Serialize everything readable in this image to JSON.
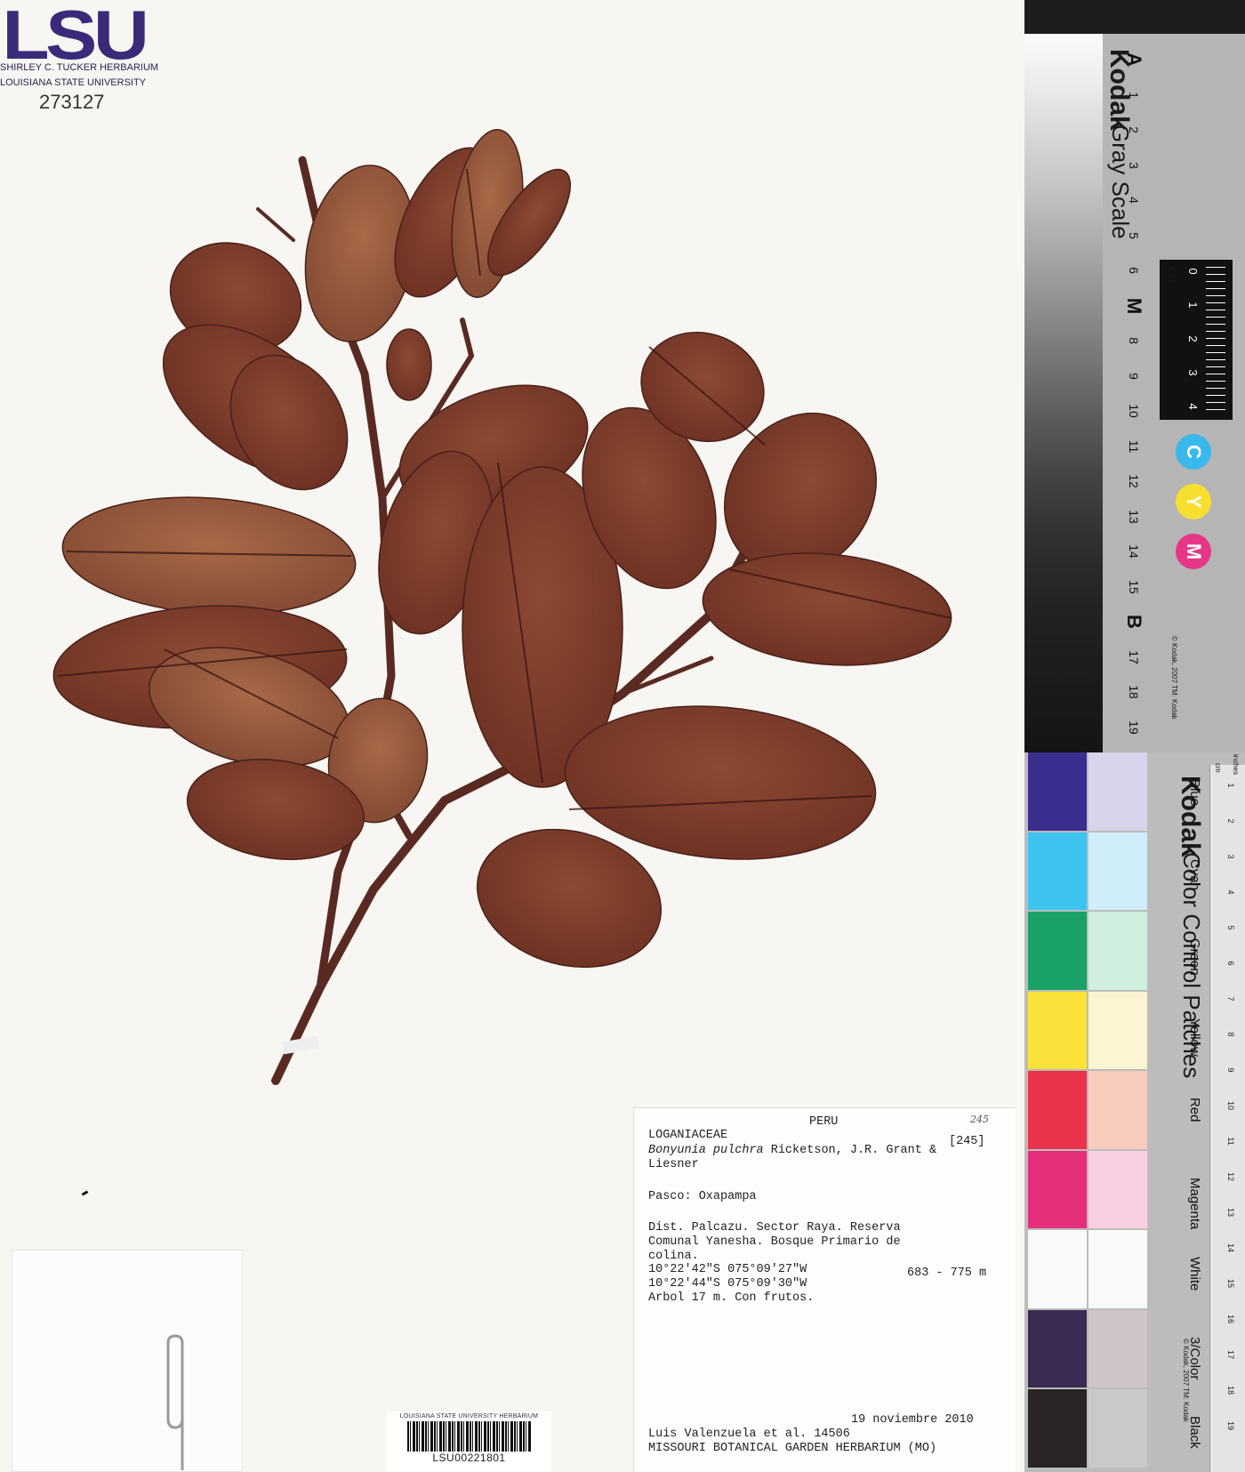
{
  "herbarium_header": {
    "logo": "LSU",
    "line1": "SHIRLEY C. TUCKER HERBARIUM",
    "line2": "LOUISIANA STATE UNIVERSITY",
    "number": "273127"
  },
  "barcode": {
    "org": "LOUISIANA STATE UNIVERSITY HERBARIUM",
    "id": "LSU00221801"
  },
  "label": {
    "country": "PERU",
    "hand_note": "245",
    "family": "LOGANIACEAE",
    "number_bracket": "[245]",
    "taxon_italic": "Bonyunia pulchra",
    "taxon_author": "Ricketson, J.R. Grant &",
    "taxon_author2": "Liesner",
    "locality_header": "Pasco: Oxapampa",
    "desc1": "Dist. Palcazu. Sector Raya. Reserva",
    "desc2": "Comunal Yanesha. Bosque Primario de",
    "desc3": "colina.",
    "coord1": "10°22'42\"S 075°09'27\"W",
    "elevation": "683 - 775 m",
    "coord2": "10°22'44\"S 075°09'30\"W",
    "habit": "Arbol 17 m. Con frutos.",
    "date": "19 noviembre 2010",
    "collector": "Luis Valenzuela et al. 14506",
    "institution": "MISSOURI BOTANICAL GARDEN HERBARIUM (MO)"
  },
  "gray_scale": {
    "brand": "Kodak",
    "title": "Gray Scale",
    "steps": [
      "A",
      "1",
      "2",
      "3",
      "4",
      "5",
      "6",
      "M",
      "8",
      "9",
      "10",
      "11",
      "12",
      "13",
      "14",
      "15",
      "B",
      "17",
      "18",
      "19"
    ],
    "cm_label": "cm",
    "cm_ticks": [
      "0",
      "1",
      "2",
      "3",
      "4"
    ],
    "cmy": [
      "C",
      "Y",
      "M"
    ],
    "copyright": "© Kodak, 2007 TM: Kodak"
  },
  "color_scale": {
    "brand": "Kodak",
    "title": "Color Control Patches",
    "patch_labels": [
      "Blue",
      "Cyan",
      "Green",
      "Yellow",
      "Red",
      "Magenta",
      "White",
      "3/Color",
      "Black"
    ],
    "ruler_units": [
      "cm",
      "inches"
    ],
    "ruler_numbers": [
      "1",
      "2",
      "3",
      "4",
      "5",
      "6",
      "7",
      "8",
      "9",
      "10",
      "11",
      "12",
      "13",
      "14",
      "15",
      "16",
      "17",
      "18",
      "19"
    ],
    "copyright": "© Kodak, 2007 TM: Kodak",
    "colors": {
      "blue": "#3a2f8e",
      "blue_light": "#d9d4ec",
      "cyan": "#3cc4ef",
      "cyan_light": "#cfeefa",
      "green": "#1aa266",
      "green_light": "#cfeedd",
      "yellow": "#fbe23a",
      "yellow_light": "#fbf5d2",
      "red": "#e8334a",
      "red_light": "#f8cbbd",
      "magenta": "#e4307a",
      "magenta_light": "#f9cfe2",
      "white": "#fafafa",
      "three_color": "#3a2b54",
      "three_color_light": "#cfc4c8",
      "black": "#2a2424",
      "black_light": "#c9c9c9"
    }
  },
  "specimen_colors": {
    "leaf": "#7d3b2a",
    "leaf_light": "#9a5a3e",
    "stem": "#5a2a22"
  }
}
